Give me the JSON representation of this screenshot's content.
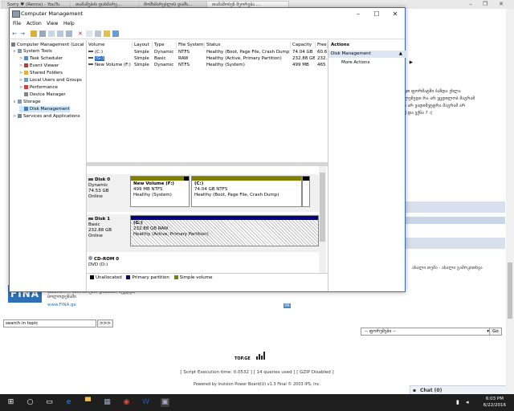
{
  "browser": {
    "tabs": [
      "Sorry ♥ (Remix) - YouTu",
      "თამაშების დახმარე...",
      "მომხმარებლის დამხ...",
      "თამაშობენ მეორება ..."
    ],
    "active_tab": 3
  },
  "webpage": {
    "right_text": [
      "ვთ ფორმატში ბაზდა ეხლა",
      "ლემედი რა არ ვცდილობ მაგრამ",
      "ნ არ ვადიმეტტრა მაგრამ არ",
      "ქ და ვქნა ? :("
    ],
    "nav_text": "ახალი თემა · ახალი გამოკითხვა",
    "fina_logo": "FINA",
    "fina_text": "საწარმოო, ნარომოება, დიზაინი, ბეჭდვა, ბოლოდენაში",
    "fina_url": "www.FINA.ge",
    "ipb_badge": "IPB",
    "search": {
      "placeholder": "search in topic",
      "button": ">>>"
    },
    "jump": {
      "value": "-- ფორუმები --",
      "go": "Go"
    },
    "top_logo": "TOP.GE",
    "footer_exec": "[ Script Execution time: 0.0532 ]   [ 14 queries used ]   [ GZIP Disabled ]",
    "footer_powered": "Powered by Invision Power Board(U) v1.3 Final © 2003  IPS, Inc.",
    "chat": "Chat (0)"
  },
  "window": {
    "title": "Computer Management",
    "menu": [
      "File",
      "Action",
      "View",
      "Help"
    ],
    "tree": [
      {
        "label": "Computer Management (Local",
        "level": 0,
        "toggle": "",
        "icon": "#6e7f95"
      },
      {
        "label": "System Tools",
        "level": 1,
        "toggle": "∨",
        "icon": "#8899aa"
      },
      {
        "label": "Task Scheduler",
        "level": 2,
        "toggle": ">",
        "icon": "#5a8ac6"
      },
      {
        "label": "Event Viewer",
        "level": 2,
        "toggle": ">",
        "icon": "#b04040"
      },
      {
        "label": "Shared Folders",
        "level": 2,
        "toggle": ">",
        "icon": "#e0b040"
      },
      {
        "label": "Local Users and Groups",
        "level": 2,
        "toggle": ">",
        "icon": "#6a9bd1"
      },
      {
        "label": "Performance",
        "level": 2,
        "toggle": ">",
        "icon": "#d04040"
      },
      {
        "label": "Device Manager",
        "level": 2,
        "toggle": "",
        "icon": "#7a8896"
      },
      {
        "label": "Storage",
        "level": 1,
        "toggle": "∨",
        "icon": "#8899aa"
      },
      {
        "label": "Disk Management",
        "level": 2,
        "toggle": "",
        "icon": "#4a7ab5",
        "selected": true
      },
      {
        "label": "Services and Applications",
        "level": 1,
        "toggle": ">",
        "icon": "#7a8896"
      }
    ],
    "table": {
      "headers": [
        "Volume",
        "Layout",
        "Type",
        "File System",
        "Status",
        "Capacity",
        "Free"
      ],
      "rows": [
        [
          "(C:)",
          "Simple",
          "Dynamic",
          "NTFS",
          "Healthy (Boot, Page File, Crash Dump)",
          "74.04 GB",
          "60.6"
        ],
        [
          "(G:)",
          "Simple",
          "Basic",
          "RAW",
          "Healthy (Active, Primary Partition)",
          "232.88 GB",
          "232."
        ],
        [
          "New Volume (F:)",
          "Simple",
          "Dynamic",
          "NTFS",
          "Healthy (System)",
          "499 MB",
          "465"
        ]
      ],
      "selected_row": 1
    },
    "disks": [
      {
        "name": "Disk 0",
        "type": "Dynamic",
        "size": "74.53 GB",
        "state": "Online",
        "partitions": [
          {
            "name": "New Volume  (F:)",
            "size": "499 MB NTFS",
            "status": "Healthy (System)"
          },
          {
            "name": "(C:)",
            "size": "74.04 GB NTFS",
            "status": "Healthy (Boot, Page File, Crash Dump)"
          }
        ]
      },
      {
        "name": "Disk 1",
        "type": "Basic",
        "size": "232.88 GB",
        "state": "Online",
        "partitions": [
          {
            "name": "(G:)",
            "size": "232.88 GB RAW",
            "status": "Healthy (Active, Primary Partition)"
          }
        ]
      },
      {
        "name": "CD-ROM 0",
        "type": "DVD (D:)",
        "size": "",
        "state": "No Media",
        "partitions": []
      }
    ],
    "legend": [
      "Unallocated",
      "Primary partition",
      "Simple volume"
    ],
    "colors": {
      "unallocated": "#000000",
      "primary": "#000080",
      "simple": "#808000",
      "selection": "#cce8ff"
    },
    "actions": {
      "header": "Actions",
      "section": "Disk Management",
      "more": "More Actions"
    }
  },
  "taskbar": {
    "icons": [
      "windows-start-icon",
      "search-icon",
      "task-view-icon",
      "edge-icon",
      "file-explorer-icon",
      "store-icon",
      "chrome-icon",
      "word-icon",
      "computer-management-icon"
    ],
    "time": "6:03 PM",
    "date": "6/22/2016"
  }
}
